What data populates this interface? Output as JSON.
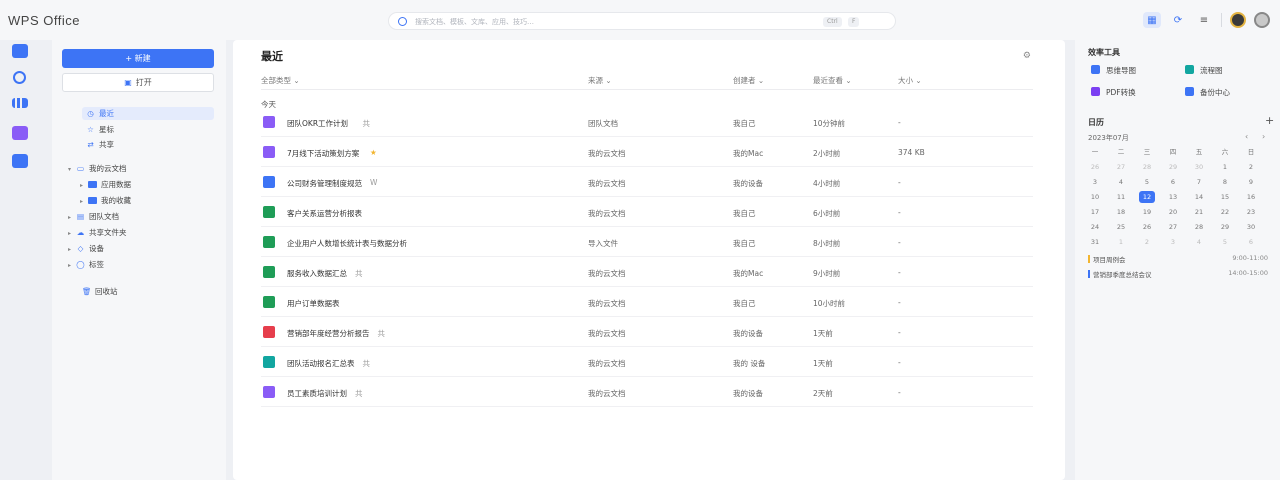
{
  "app": {
    "logo": "WPS Office"
  },
  "search": {
    "placeholder": "搜索文档、模板、文库、应用、技巧…",
    "kbd1": "Ctrl",
    "kbd2": "F"
  },
  "toolbar": {
    "view_icon": "grid-icon",
    "sync_icon": "sync-icon",
    "menu_icon": "menu-icon"
  },
  "colors": {
    "accent": "#3d74f5",
    "doc": "#8a5cf6",
    "word": "#3d74f5",
    "sheet": "#1f9d57",
    "ppt": "#e63e4c",
    "pdf": "#7b3ff2",
    "form": "#12a6a0"
  },
  "left": {
    "new_label": "+ 新建",
    "open_label": "打开",
    "nav": [
      {
        "icon": "clock-icon",
        "label": "最近"
      },
      {
        "icon": "star-icon",
        "label": "星标"
      },
      {
        "icon": "share-icon",
        "label": "共享"
      }
    ],
    "tree": [
      {
        "label": "我的云文档",
        "level": 0,
        "icon": "cloud-doc-icon"
      },
      {
        "label": "应用数据",
        "level": 1,
        "icon": "folder-icon"
      },
      {
        "label": "我的收藏",
        "level": 1,
        "icon": "folder-icon"
      },
      {
        "label": "团队文档",
        "level": 0,
        "icon": "team-icon"
      },
      {
        "label": "共享文件夹",
        "level": 0,
        "icon": "shared-folder-icon"
      },
      {
        "label": "设备",
        "level": 0,
        "icon": "device-icon"
      },
      {
        "label": "标签",
        "level": 0,
        "icon": "tag-icon"
      }
    ],
    "trash": "回收站"
  },
  "main": {
    "title": "最近",
    "columns": [
      "全部类型",
      "来源",
      "创建者",
      "最近查看",
      "大小"
    ],
    "group": "今天",
    "rows": [
      {
        "type": "doc",
        "name": "团队OKR工作计划",
        "badge": "共",
        "source": "团队文档",
        "creator": "我自己",
        "viewed": "10分钟前",
        "size": "-"
      },
      {
        "type": "doc",
        "name": "7月线下活动策划方案",
        "badge": "★",
        "source": "我的云文档",
        "creator": "我的Mac",
        "viewed": "2小时前",
        "size": "374 KB"
      },
      {
        "type": "word",
        "name": "公司财务管理制度规范",
        "badge": "W",
        "source": "我的云文档",
        "creator": "我的设备",
        "viewed": "4小时前",
        "size": "-"
      },
      {
        "type": "sheet",
        "name": "客户关系运营分析报表",
        "badge": "",
        "source": "我的云文档",
        "creator": "我自己",
        "viewed": "6小时前",
        "size": "-"
      },
      {
        "type": "sheet",
        "name": "企业用户人数增长统计表与数据分析",
        "badge": "",
        "source": "导入文件",
        "creator": "我自己",
        "viewed": "8小时前",
        "size": "-"
      },
      {
        "type": "sheet",
        "name": "服务收入数据汇总",
        "badge": "共",
        "source": "我的云文档",
        "creator": "我的Mac",
        "viewed": "9小时前",
        "size": "-"
      },
      {
        "type": "sheet",
        "name": "用户订单数据表",
        "badge": "",
        "source": "我的云文档",
        "creator": "我自己",
        "viewed": "10小时前",
        "size": "-"
      },
      {
        "type": "ppt",
        "name": "营销部年度经营分析报告",
        "badge": "共",
        "source": "我的云文档",
        "creator": "我的设备",
        "viewed": "1天前",
        "size": "-"
      },
      {
        "type": "form",
        "name": "团队活动报名汇总表",
        "badge": "共",
        "source": "我的云文档",
        "creator": "我的 设备",
        "viewed": "1天前",
        "size": "-"
      },
      {
        "type": "doc",
        "name": "员工素质培训计划",
        "badge": "共",
        "source": "我的云文档",
        "creator": "我的设备",
        "viewed": "2天前",
        "size": "-"
      }
    ]
  },
  "right": {
    "tools_title": "效率工具",
    "tools": [
      {
        "label": "思维导图",
        "icon": "mindmap-icon"
      },
      {
        "label": "流程图",
        "icon": "flowchart-icon"
      },
      {
        "label": "PDF转换",
        "icon": "pdf-icon"
      },
      {
        "label": "备份中心",
        "icon": "backup-icon"
      }
    ],
    "calendar_title": "日历",
    "calendar_add": "+",
    "month": "2023年07月",
    "prev": "‹",
    "next": "›",
    "weekdays": [
      "一",
      "二",
      "三",
      "四",
      "五",
      "六",
      "日"
    ],
    "weeks": [
      [
        "26",
        "27",
        "28",
        "29",
        "30",
        "1",
        "2"
      ],
      [
        "3",
        "4",
        "5",
        "6",
        "7",
        "8",
        "9"
      ],
      [
        "10",
        "11",
        "12",
        "13",
        "14",
        "15",
        "16"
      ],
      [
        "17",
        "18",
        "19",
        "20",
        "21",
        "22",
        "23"
      ],
      [
        "24",
        "25",
        "26",
        "27",
        "28",
        "29",
        "30"
      ],
      [
        "31",
        "1",
        "2",
        "3",
        "4",
        "5",
        "6"
      ]
    ],
    "today": "12",
    "events": [
      {
        "title": "项目周例会",
        "time": "9:00-11:00",
        "color": "#f2b530"
      },
      {
        "title": "营销部季度总结会议",
        "time": "14:00-15:00",
        "color": "#3d74f5"
      }
    ]
  }
}
